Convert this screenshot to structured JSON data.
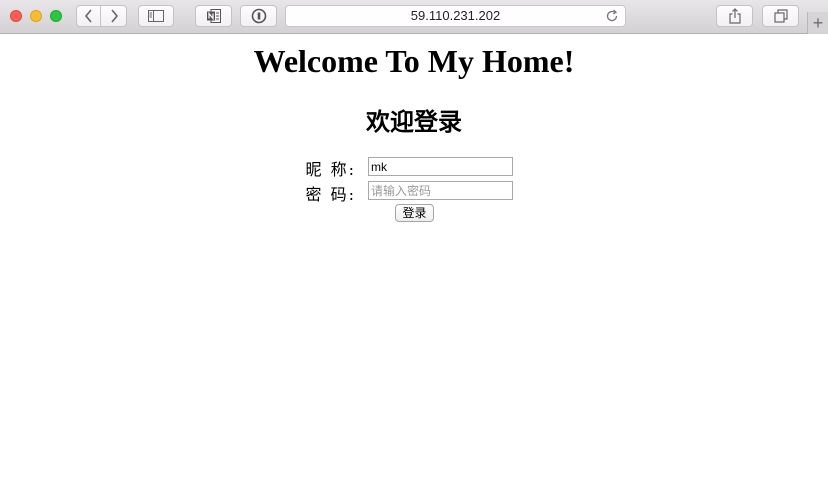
{
  "browser": {
    "url": "59.110.231.202",
    "icons": {
      "back": "chevron-left-icon",
      "forward": "chevron-right-icon",
      "sidebar": "sidebar-icon",
      "onenote": "onenote-icon",
      "password": "password-manager-icon",
      "reload": "reload-icon",
      "share": "share-icon",
      "tabs": "tabs-overview-icon",
      "new_tab": "plus-icon"
    },
    "new_tab_glyph": "+"
  },
  "page": {
    "title": "Welcome To My Home!",
    "subtitle": "欢迎登录",
    "form": {
      "nickname_label": "昵 称:",
      "nickname_value": "mk",
      "password_label": "密 码:",
      "password_placeholder": "请输入密码",
      "submit_label": "登录"
    }
  },
  "colors": {
    "close": "#fc5f57",
    "minimize": "#fdbc2e",
    "zoom": "#28c840"
  }
}
